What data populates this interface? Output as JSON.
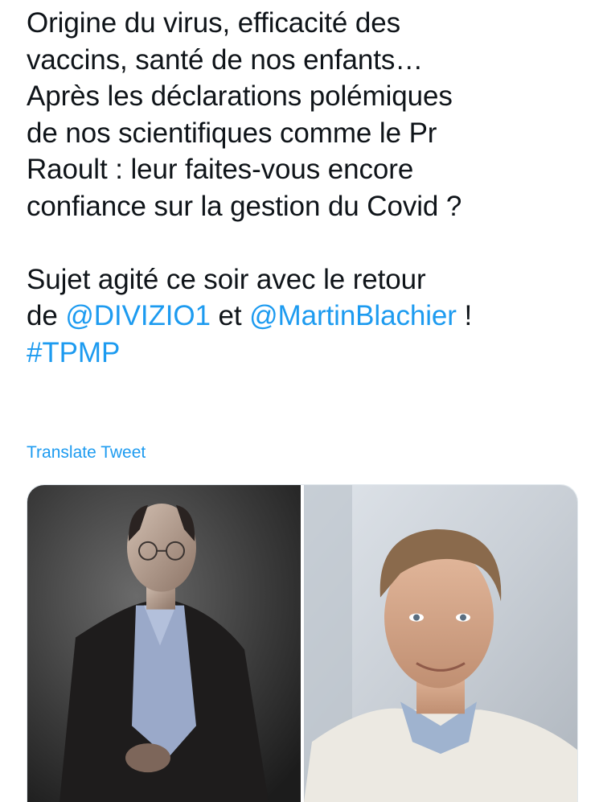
{
  "tweet": {
    "lines": [
      "Origine du virus, efficacité des",
      "vaccins, santé de nos enfants…",
      "Après les déclarations polémiques",
      "de nos scientifiques comme le Pr",
      "Raoult : leur faites-vous encore",
      "confiance sur la gestion du Covid ?"
    ],
    "line7": "Sujet agité ce soir avec le retour",
    "line8_prefix": "de ",
    "mention_1": "@DIVIZIO1",
    "line8_middle": " et ",
    "mention_2": "@MartinBlachier",
    "line8_suffix": " !",
    "hashtag": "#TPMP"
  },
  "translate_label": "Translate Tweet",
  "media": {
    "count": 2,
    "photos": [
      "photo-man-glasses-dark-jacket",
      "photo-man-white-sweater"
    ]
  },
  "colors": {
    "text": "#0f1419",
    "link": "#1d9bf0",
    "background": "#ffffff"
  }
}
